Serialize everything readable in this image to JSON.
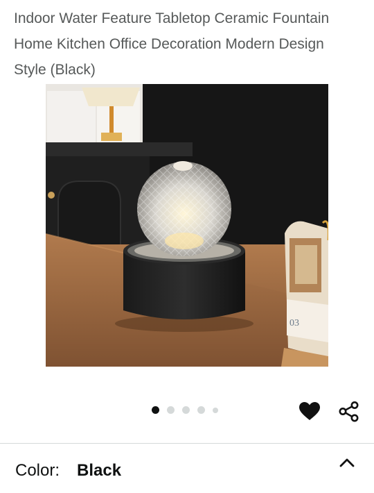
{
  "product": {
    "title": "Indoor Water Feature Tabletop Ceramic Fountain Home Kitchen Office Decoration Modern Design Style (Black)"
  },
  "gallery": {
    "image_subject": "black-fountain-glass-sphere",
    "calendar_text": "03",
    "total_images": 5,
    "current_index": 1
  },
  "actions": {
    "favorite_icon": "heart-icon",
    "share_icon": "share-icon"
  },
  "variant": {
    "label": "Color:",
    "value": "Black",
    "expand_icon": "chevron-up-icon"
  }
}
